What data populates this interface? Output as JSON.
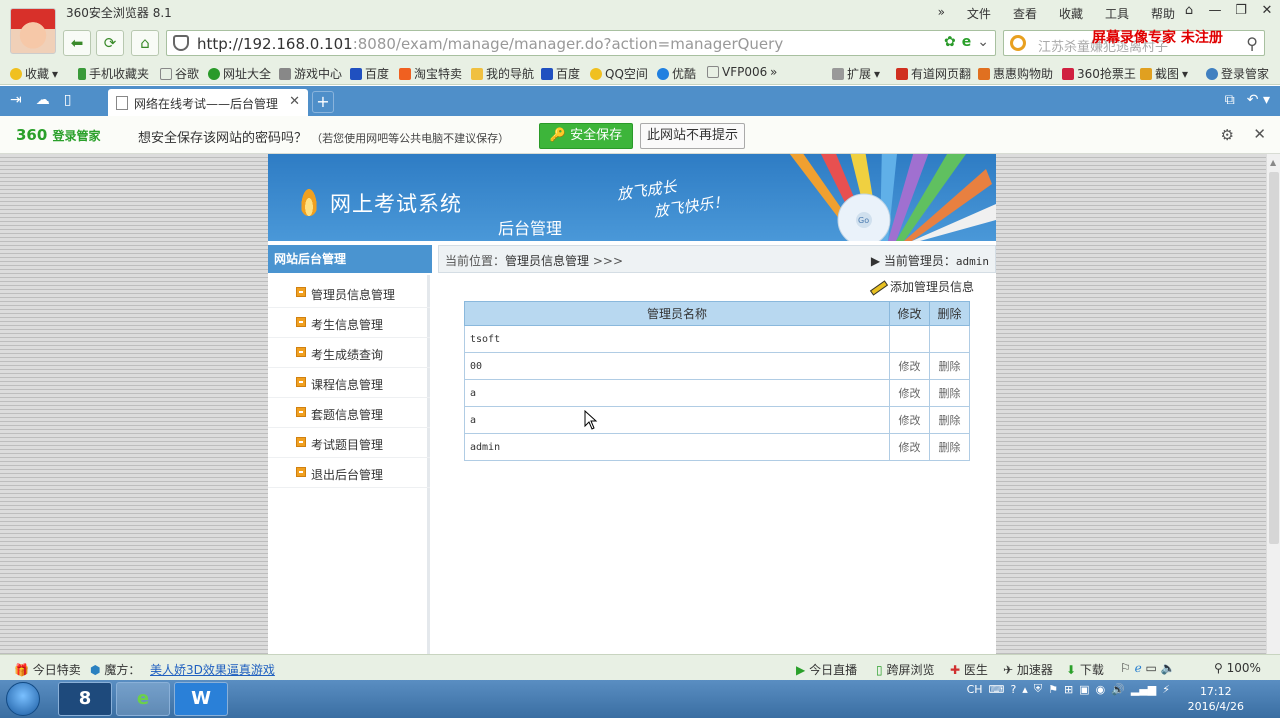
{
  "browser": {
    "app_title": "360安全浏览器 8.1",
    "menu": [
      "文件",
      "查看",
      "收藏",
      "工具",
      "帮助"
    ],
    "url_host": "http://192.168.0.101",
    "url_rest": ":8080/exam/manage/manager.do?action=managerQuery",
    "search_placeholder": "江苏杀童嫌犯逃离村子",
    "watermark": "屏幕录像专家  未注册",
    "bookmarks": [
      "收藏",
      "手机收藏夹",
      "谷歌",
      "网址大全",
      "游戏中心",
      "百度",
      "淘宝特卖",
      "我的导航",
      "百度",
      "QQ空间",
      "优酷",
      "VFP006",
      "扩展",
      "有道网页翻",
      "惠惠购物助",
      "360抢票王",
      "截图",
      "登录管家"
    ],
    "tab_title": "网络在线考试——后台管理",
    "new_tab": "+"
  },
  "password_bar": {
    "logo": "360",
    "logo_sub": "登录管家",
    "question": "想安全保存该网站的密码吗？",
    "note": "（若您使用网吧等公共电脑不建议保存）",
    "save_label": "安全保存",
    "never_label": "此网站不再提示"
  },
  "site": {
    "title": "网上考试系统",
    "subtitle": "后台管理",
    "slogan_1": "放飞成长",
    "slogan_2": "放飞快乐！",
    "sidebar_heading": "网站后台管理",
    "breadcrumb_prefix": "当前位置：",
    "breadcrumb_page": "管理员信息管理",
    "breadcrumb_arrows": ">>>",
    "current_admin_label": "当前管理员：",
    "current_admin": "admin",
    "menu": [
      {
        "label": "管理员信息管理"
      },
      {
        "label": "考生信息管理"
      },
      {
        "label": "考生成绩查询"
      },
      {
        "label": "课程信息管理"
      },
      {
        "label": "套题信息管理"
      },
      {
        "label": "考试题目管理"
      },
      {
        "label": "退出后台管理"
      }
    ],
    "add_link": "添加管理员信息",
    "table": {
      "headers": [
        "管理员名称",
        "修改",
        "删除"
      ],
      "rows": [
        {
          "name": "tsoft",
          "edit": "",
          "del": ""
        },
        {
          "name": "00",
          "edit": "修改",
          "del": "删除"
        },
        {
          "name": "a",
          "edit": "修改",
          "del": "删除"
        },
        {
          "name": "a",
          "edit": "修改",
          "del": "删除"
        },
        {
          "name": "admin",
          "edit": "修改",
          "del": "删除"
        }
      ]
    }
  },
  "statusbar": {
    "today_sale": "今日特卖",
    "mofang": "魔方：",
    "ad_link": "美人娇3D效果逼真游戏",
    "live": "今日直播",
    "split": "跨屏浏览",
    "doctor": "医生",
    "accel": "加速器",
    "download": "下载",
    "zoom": "100%"
  },
  "taskbar": {
    "lang": "CH",
    "time": "17:12",
    "date": "2016/4/26"
  }
}
